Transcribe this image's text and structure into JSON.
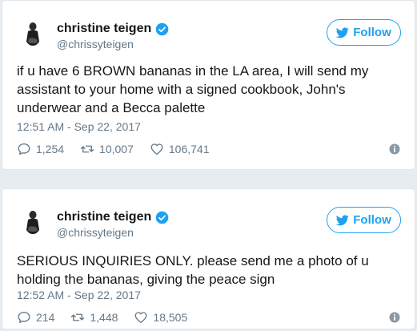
{
  "colors": {
    "accent": "#1da1f2",
    "muted": "#657786",
    "text": "#14171a",
    "border": "#e1e8ed"
  },
  "tweets": [
    {
      "name": "christine teigen",
      "handle": "@chrissyteigen",
      "verified_icon": "verified-badge-icon",
      "follow_label": "Follow",
      "text": "if u have 6 BROWN bananas in the LA area, I will send my assistant to your home with a signed cookbook, John's underwear and a Becca palette",
      "timestamp": "12:51 AM - Sep 22, 2017",
      "replies": "1,254",
      "retweets": "10,007",
      "likes": "106,741"
    },
    {
      "name": "christine teigen",
      "handle": "@chrissyteigen",
      "verified_icon": "verified-badge-icon",
      "follow_label": "Follow",
      "text": "SERIOUS INQUIRIES ONLY. please send me a photo of u holding the bananas, giving the peace sign",
      "timestamp": "12:52 AM - Sep 22, 2017",
      "replies": "214",
      "retweets": "1,448",
      "likes": "18,505"
    }
  ]
}
